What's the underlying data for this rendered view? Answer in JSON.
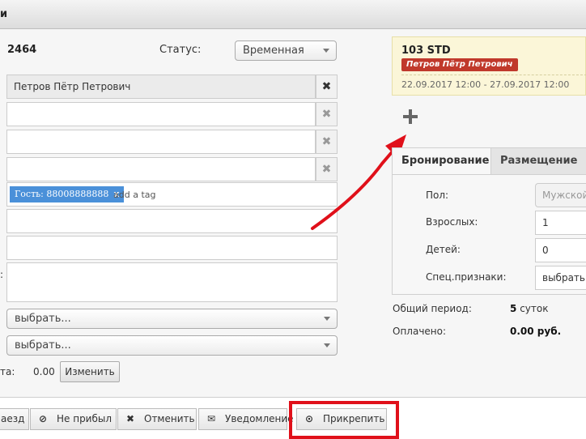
{
  "window": {
    "title_fragment": "и"
  },
  "booking": {
    "number": "2464",
    "status_label": "Статус:",
    "status_value": "Временная"
  },
  "guest_fields": {
    "guest_name": "Петров Пётр Петрович",
    "tag_label": "Гость: 88008888888",
    "tag_remove": "x",
    "tag_placeholder": "add a tag",
    "clear_symbol": "✖"
  },
  "selects": {
    "first": "выбрать...",
    "second": "выбрать..."
  },
  "payment": {
    "label_fragment": "та:",
    "amount": "0.00",
    "change_button": "Изменить"
  },
  "colon_fragment": ":",
  "room_card": {
    "title": "103 STD",
    "guest": "Петров Пётр Петрович",
    "dates": "22.09.2017 12:00 - 27.09.2017 12:00"
  },
  "tabs": {
    "booking": "Бронирование",
    "placement": "Размещение"
  },
  "booking_tab": {
    "gender_label": "Пол:",
    "gender_value": "Мужской",
    "adults_label": "Взрослых:",
    "adults_value": "1",
    "children_label": "Детей:",
    "children_value": "0",
    "special_label": "Спец.признаки:",
    "special_value": "выбрать..."
  },
  "summary": {
    "period_label": "Общий период:",
    "period_value": "5",
    "period_unit": "суток",
    "paid_label": "Оплачено:",
    "paid_value": "0.00 руб."
  },
  "footer": {
    "checkin": "аезд",
    "noshow": "Не прибыл",
    "cancel": "Отменить",
    "notify": "Уведомление",
    "attach": "Прикрепить"
  },
  "colors": {
    "annotation": "#e0101a",
    "tag": "#4a90d9",
    "badge": "#c0392b"
  },
  "icons": [
    "close-icon",
    "plus-icon",
    "ban-icon",
    "envelope-icon",
    "upload-icon",
    "red-arrow-annotation"
  ]
}
